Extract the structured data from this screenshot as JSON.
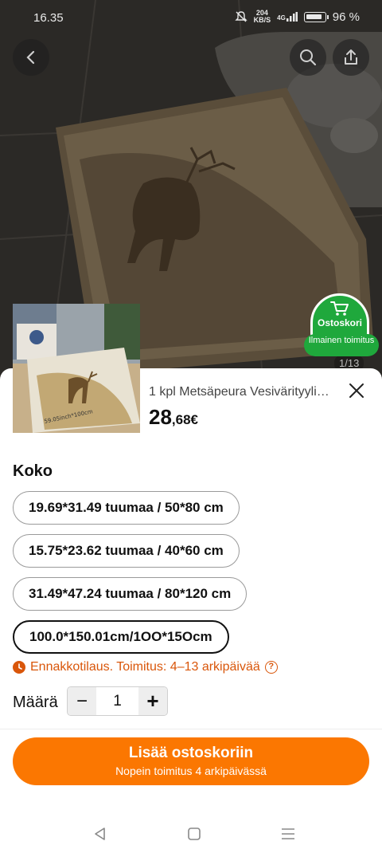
{
  "status_bar": {
    "time": "16.35",
    "data_rate": "204",
    "data_unit": "KB/S",
    "network": "4G",
    "battery": "96 %"
  },
  "header": {
    "back_icon": "chevron-left-icon",
    "search_icon": "search-icon",
    "share_icon": "share-icon"
  },
  "gallery": {
    "counter": "1/13",
    "thumb_dimensions_text": "59.05inch*100cm"
  },
  "cart_badge": {
    "label": "Ostoskori",
    "shipping": "Ilmainen toimitus",
    "color": "#1fa83c"
  },
  "product": {
    "title": "1 kpl Metsäpeura Vesivärityylinen",
    "price_int": "28",
    "price_dec": ",68€"
  },
  "size": {
    "label": "Koko",
    "options": [
      {
        "label": "19.69*31.49 tuumaa / 50*80 cm",
        "selected": false
      },
      {
        "label": "15.75*23.62 tuumaa / 40*60 cm",
        "selected": false
      },
      {
        "label": "31.49*47.24 tuumaa / 80*120 cm",
        "selected": false
      },
      {
        "label": "100.0*150.01cm/1OO*15Ocm",
        "selected": true
      }
    ]
  },
  "preorder": {
    "text": "Ennakkotilaus. Toimitus: 4–13 arkipäivää",
    "help": "?",
    "color": "#d9560a"
  },
  "quantity": {
    "label": "Määrä",
    "value": "1",
    "minus": "−",
    "plus": "+"
  },
  "add_to_cart": {
    "label": "Lisää ostoskoriin",
    "sub_label": "Nopein toimitus 4 arkipäivässä",
    "color": "#fb7701"
  },
  "nav_bar": {
    "back_icon": "triangle-back-icon",
    "home_icon": "square-home-icon",
    "menu_icon": "menu-lines-icon"
  }
}
